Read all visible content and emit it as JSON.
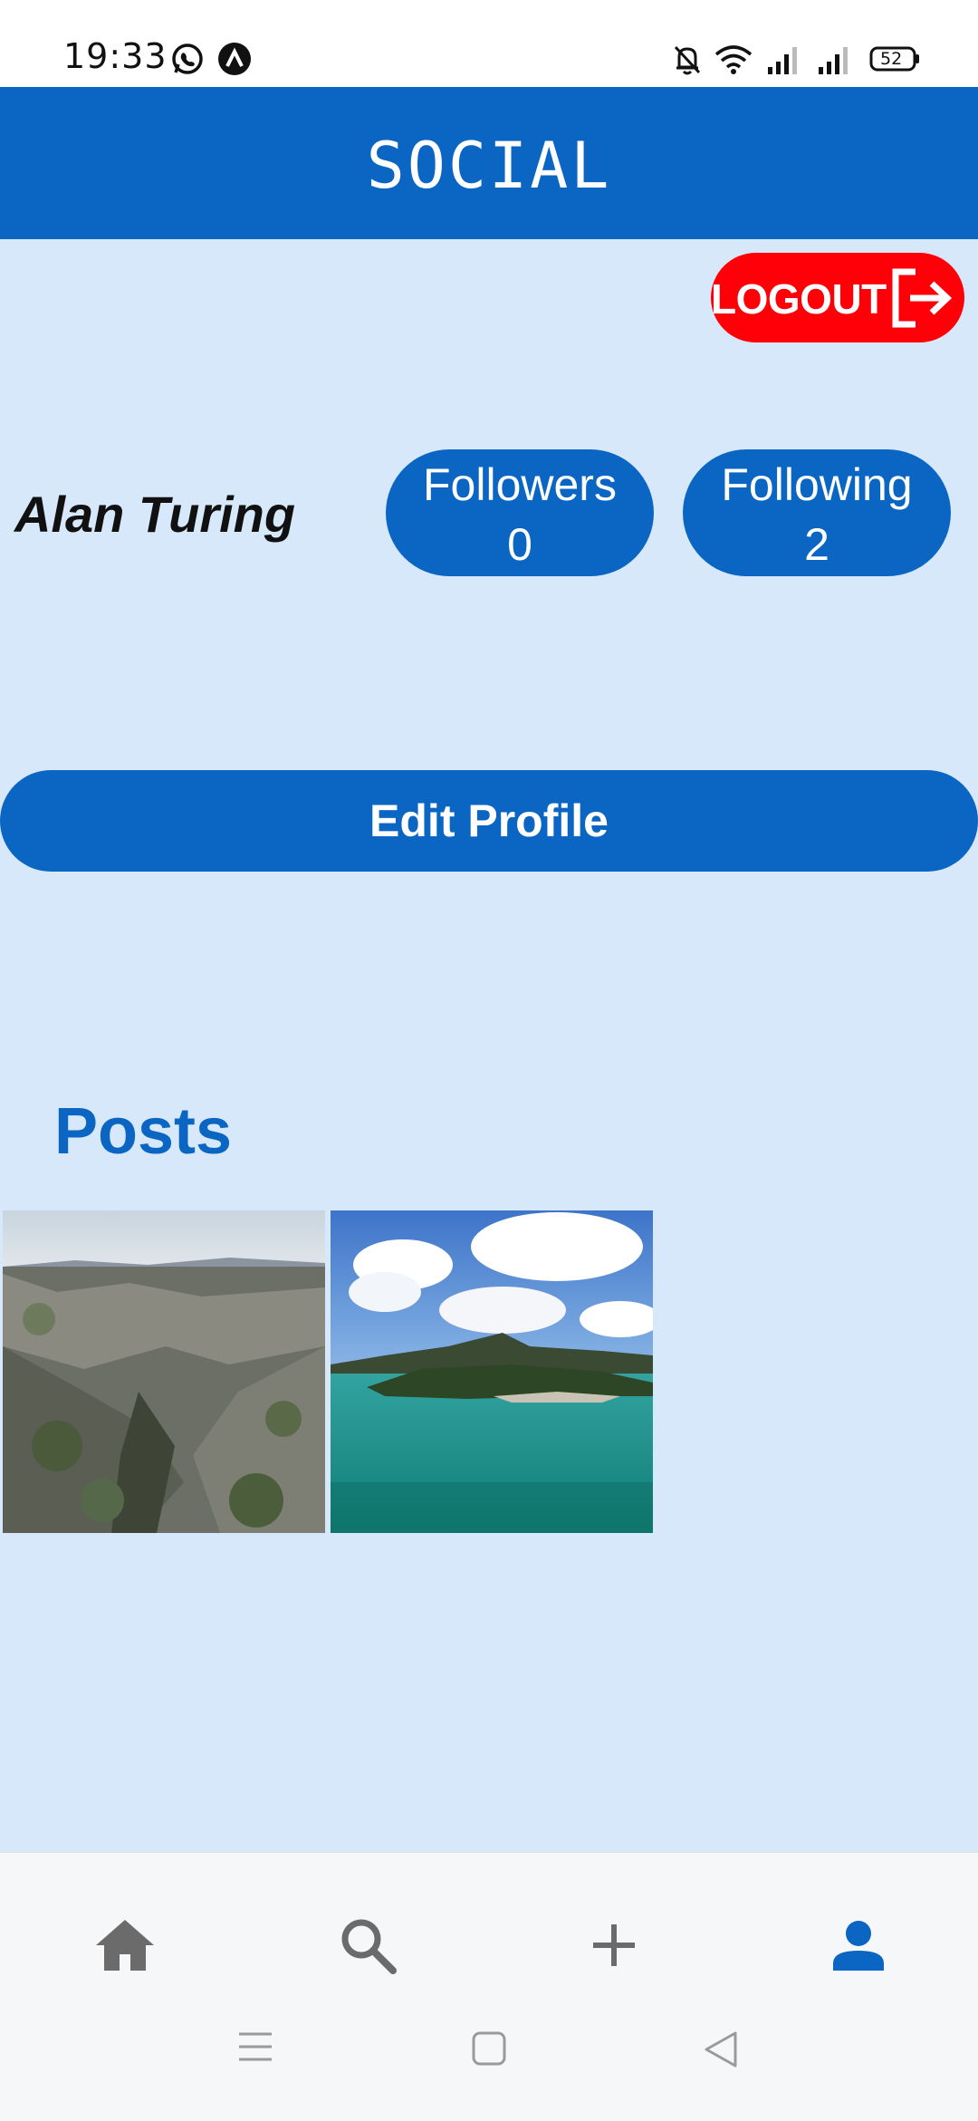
{
  "status_bar": {
    "time": "19:33",
    "battery": "52",
    "icons": [
      "whatsapp-icon",
      "app-a-icon",
      "bell-muted-icon",
      "wifi-icon",
      "signal-icon",
      "signal-icon",
      "battery-icon"
    ]
  },
  "app_bar": {
    "title": "SOCIAL"
  },
  "logout": {
    "label": "LOGOUT",
    "icon": "logout-icon",
    "color": "#ff0008"
  },
  "profile": {
    "name": "Alan Turing",
    "followers_label": "Followers",
    "followers_count": "0",
    "following_label": "Following",
    "following_count": "2"
  },
  "edit_profile": {
    "label": "Edit Profile"
  },
  "posts": {
    "title": "Posts",
    "items": [
      {
        "image": "rocky-canyon-photo"
      },
      {
        "image": "turquoise-lake-photo"
      }
    ]
  },
  "bottom_nav": {
    "items": [
      {
        "icon": "home-icon",
        "active": false
      },
      {
        "icon": "search-icon",
        "active": false
      },
      {
        "icon": "plus-icon",
        "active": false
      },
      {
        "icon": "profile-icon",
        "active": true
      }
    ]
  },
  "colors": {
    "primary": "#0b66c3",
    "background": "#d8e8fb",
    "danger": "#ff0008",
    "nav_inactive": "#6b6b6b"
  }
}
